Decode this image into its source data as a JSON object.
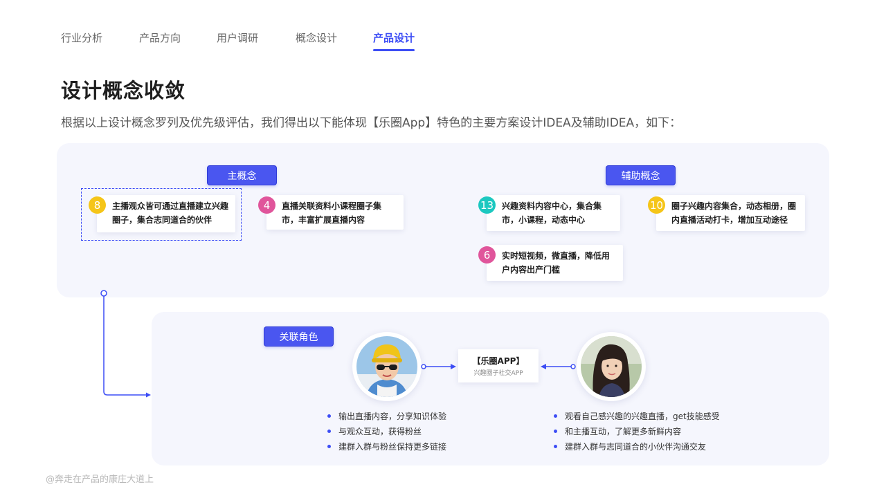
{
  "nav": {
    "tabs": [
      {
        "label": "行业分析"
      },
      {
        "label": "产品方向"
      },
      {
        "label": "用户调研"
      },
      {
        "label": "概念设计"
      },
      {
        "label": "产品设计"
      }
    ],
    "active_index": 4
  },
  "title": "设计概念收敛",
  "description": "根据以上设计概念罗列及优先级评估，我们得出以下能体现【乐圈App】特色的主要方案设计IDEA及辅助IDEA，如下：",
  "main_concept": {
    "label": "主概念",
    "items": [
      {
        "num": "8",
        "text": "主播观众皆可通过直播建立兴趣圈子，集合志同道合的伙伴",
        "color": "#f5c518"
      },
      {
        "num": "4",
        "text": "直播关联资料小课程圈子集市，丰富扩展直播内容",
        "color": "#e0559b"
      }
    ]
  },
  "aux_concept": {
    "label": "辅助概念",
    "items": [
      {
        "num": "13",
        "text": "兴趣资料内容中心，集合集市，小课程，动态中心",
        "color": "#1cc8c0"
      },
      {
        "num": "10",
        "text": "圈子兴趣内容集合，动态相册，圈内直播活动打卡，增加互动途径",
        "color": "#f5c518"
      },
      {
        "num": "6",
        "text": "实时短视频，微直播，降低用户内容出产门槛",
        "color": "#e0559b"
      }
    ]
  },
  "roles": {
    "label": "关联角色",
    "app_name": "【乐圈APP】",
    "app_sub": "兴趣圈子社交APP",
    "left_bullets": [
      "输出直播内容，分享知识体验",
      "与观众互动，获得粉丝",
      "建群入群与粉丝保持更多链接"
    ],
    "right_bullets": [
      "观看自己感兴趣的兴趣直播，get技能感受",
      "和主播互动，了解更多新鲜内容",
      "建群入群与志同道合的小伙伴沟通交友"
    ]
  },
  "watermark": "@奔走在产品的康庄大道上",
  "colors": {
    "accent": "#3c4df5",
    "tag_bg": "#4a56f0",
    "panel_bg": "#f5f6fd"
  }
}
